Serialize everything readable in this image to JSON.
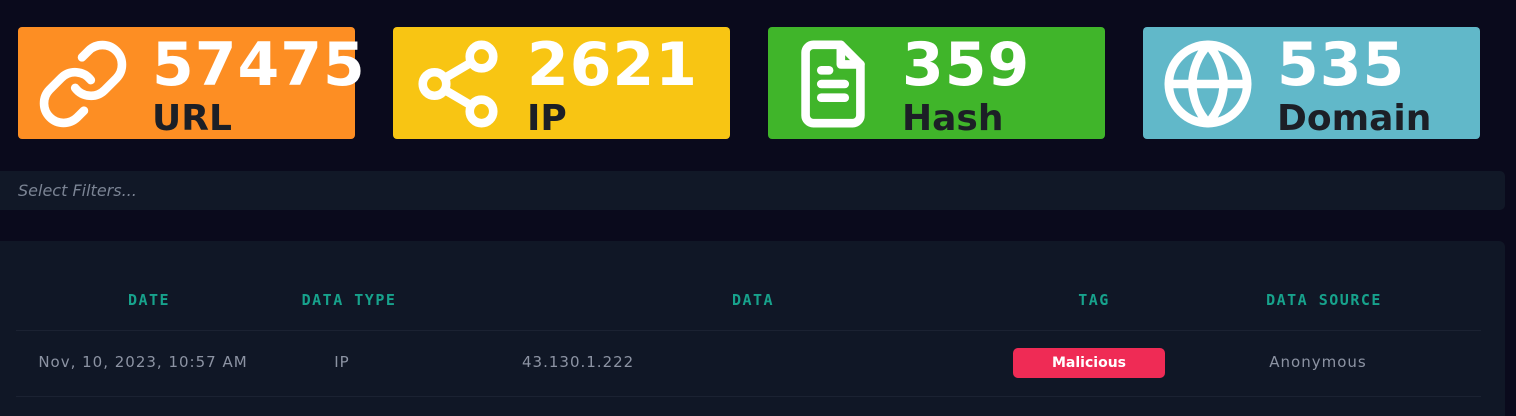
{
  "stats": [
    {
      "count": "57475",
      "label": "URL",
      "icon": "link-icon",
      "color": "#fd8e23"
    },
    {
      "count": "2621",
      "label": "IP",
      "icon": "share-icon",
      "color": "#f8c513"
    },
    {
      "count": "359",
      "label": "Hash",
      "icon": "document-icon",
      "color": "#40b52a"
    },
    {
      "count": "535",
      "label": "Domain",
      "icon": "globe-icon",
      "color": "#61b8c9"
    }
  ],
  "filter": {
    "placeholder": "Select Filters..."
  },
  "table": {
    "headers": [
      "DATE",
      "DATA TYPE",
      "DATA",
      "TAG",
      "DATA SOURCE"
    ],
    "rows": [
      {
        "date": "Nov, 10, 2023, 10:57 AM",
        "type": "IP",
        "data": "43.130.1.222",
        "tag": "Malicious",
        "source": "Anonymous"
      }
    ]
  },
  "colors": {
    "header": "#17a28c",
    "tag_malicious": "#ef2b55",
    "background": "#0a0a1c",
    "panel": "#101726"
  }
}
